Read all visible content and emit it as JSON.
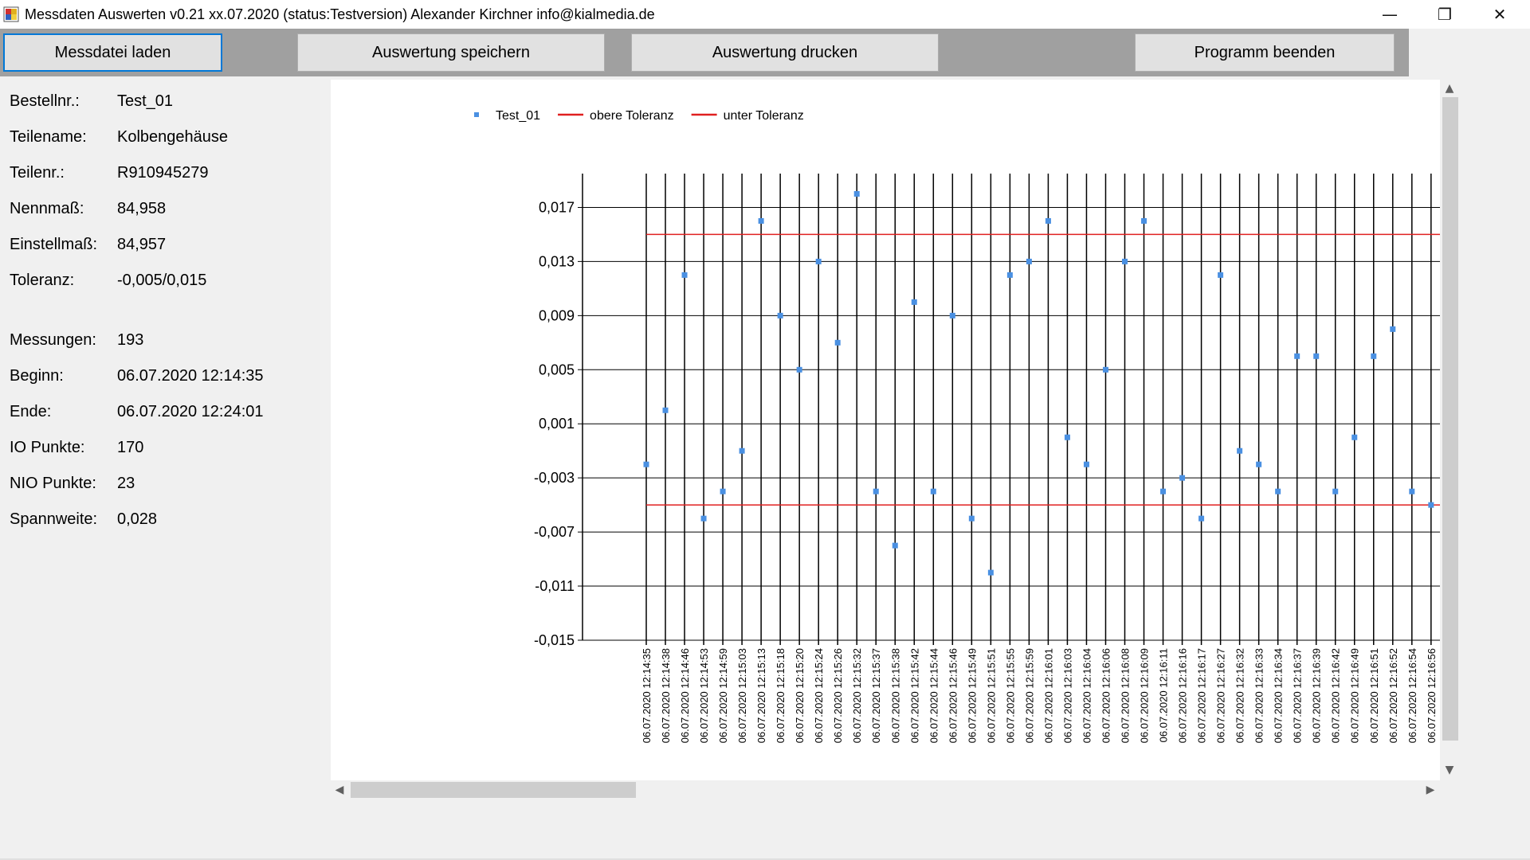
{
  "window": {
    "title": "Messdaten Auswerten v0.21 xx.07.2020 (status:Testversion) Alexander Kirchner info@kialmedia.de",
    "min_glyph": "—",
    "max_glyph": "❐",
    "close_glyph": "✕"
  },
  "toolbar": {
    "load_label": "Messdatei laden",
    "save_label": "Auswertung speichern",
    "print_label": "Auswertung drucken",
    "exit_label": "Programm beenden"
  },
  "info": [
    {
      "label": "Bestellnr.:",
      "value": "Test_01"
    },
    {
      "label": "Teilename:",
      "value": "Kolbengehäuse"
    },
    {
      "label": "Teilenr.:",
      "value": "R910945279"
    },
    {
      "label": "Nennmaß:",
      "value": "84,958"
    },
    {
      "label": "Einstellmaß:",
      "value": "84,957"
    },
    {
      "label": "Toleranz:",
      "value": "-0,005/0,015"
    },
    {
      "label": "Messungen:",
      "value": "193"
    },
    {
      "label": "Beginn:",
      "value": "06.07.2020 12:14:35"
    },
    {
      "label": "Ende:",
      "value": "06.07.2020 12:24:01"
    },
    {
      "label": "IO Punkte:",
      "value": "170"
    },
    {
      "label": "NIO Punkte:",
      "value": "23"
    },
    {
      "label": "Spannweite:",
      "value": "0,028"
    }
  ],
  "scroll": {
    "up": "▲",
    "down": "▼",
    "left": "◀",
    "right": "▶"
  },
  "colors": {
    "points": "#4a90e2",
    "tolerance": "#e02020",
    "grid": "#000000"
  },
  "chart_data": {
    "type": "scatter",
    "y_ticks": [
      "0,017",
      "0,013",
      "0,009",
      "0,005",
      "0,001",
      "-0,003",
      "-0,007",
      "-0,011",
      "-0,015"
    ],
    "ylim": [
      -0.015,
      0.0195
    ],
    "legend_position": "top-left",
    "legend": [
      {
        "name": "Test_01",
        "kind": "point",
        "color": "#4a90e2"
      },
      {
        "name": "obere Toleranz",
        "kind": "line",
        "color": "#e02020"
      },
      {
        "name": "unter Toleranz",
        "kind": "line",
        "color": "#e02020"
      }
    ],
    "tolerance_upper": 0.015,
    "tolerance_lower": -0.005,
    "x": [
      "06.07.2020 12:14:35",
      "06.07.2020 12:14:38",
      "06.07.2020 12:14:46",
      "06.07.2020 12:14:53",
      "06.07.2020 12:14:59",
      "06.07.2020 12:15:03",
      "06.07.2020 12:15:13",
      "06.07.2020 12:15:18",
      "06.07.2020 12:15:20",
      "06.07.2020 12:15:24",
      "06.07.2020 12:15:26",
      "06.07.2020 12:15:32",
      "06.07.2020 12:15:37",
      "06.07.2020 12:15:38",
      "06.07.2020 12:15:42",
      "06.07.2020 12:15:44",
      "06.07.2020 12:15:46",
      "06.07.2020 12:15:49",
      "06.07.2020 12:15:51",
      "06.07.2020 12:15:55",
      "06.07.2020 12:15:59",
      "06.07.2020 12:16:01",
      "06.07.2020 12:16:03",
      "06.07.2020 12:16:04",
      "06.07.2020 12:16:06",
      "06.07.2020 12:16:08",
      "06.07.2020 12:16:09",
      "06.07.2020 12:16:11",
      "06.07.2020 12:16:16",
      "06.07.2020 12:16:17",
      "06.07.2020 12:16:27",
      "06.07.2020 12:16:32",
      "06.07.2020 12:16:33",
      "06.07.2020 12:16:34",
      "06.07.2020 12:16:37",
      "06.07.2020 12:16:39",
      "06.07.2020 12:16:42",
      "06.07.2020 12:16:49",
      "06.07.2020 12:16:51",
      "06.07.2020 12:16:52",
      "06.07.2020 12:16:54",
      "06.07.2020 12:16:56"
    ],
    "series": [
      {
        "name": "Test_01",
        "values": [
          -0.002,
          0.002,
          0.012,
          -0.006,
          -0.004,
          -0.001,
          0.016,
          0.009,
          0.005,
          0.013,
          0.007,
          0.018,
          -0.004,
          -0.008,
          0.01,
          -0.004,
          0.009,
          -0.006,
          -0.01,
          0.012,
          0.013,
          0.016,
          0.0,
          -0.002,
          0.005,
          0.013,
          0.016,
          -0.004,
          -0.003,
          -0.006,
          0.012,
          -0.001,
          -0.002,
          -0.004,
          0.006,
          0.006,
          -0.004,
          0.0,
          0.006,
          0.008,
          -0.004,
          -0.005
        ]
      }
    ]
  }
}
